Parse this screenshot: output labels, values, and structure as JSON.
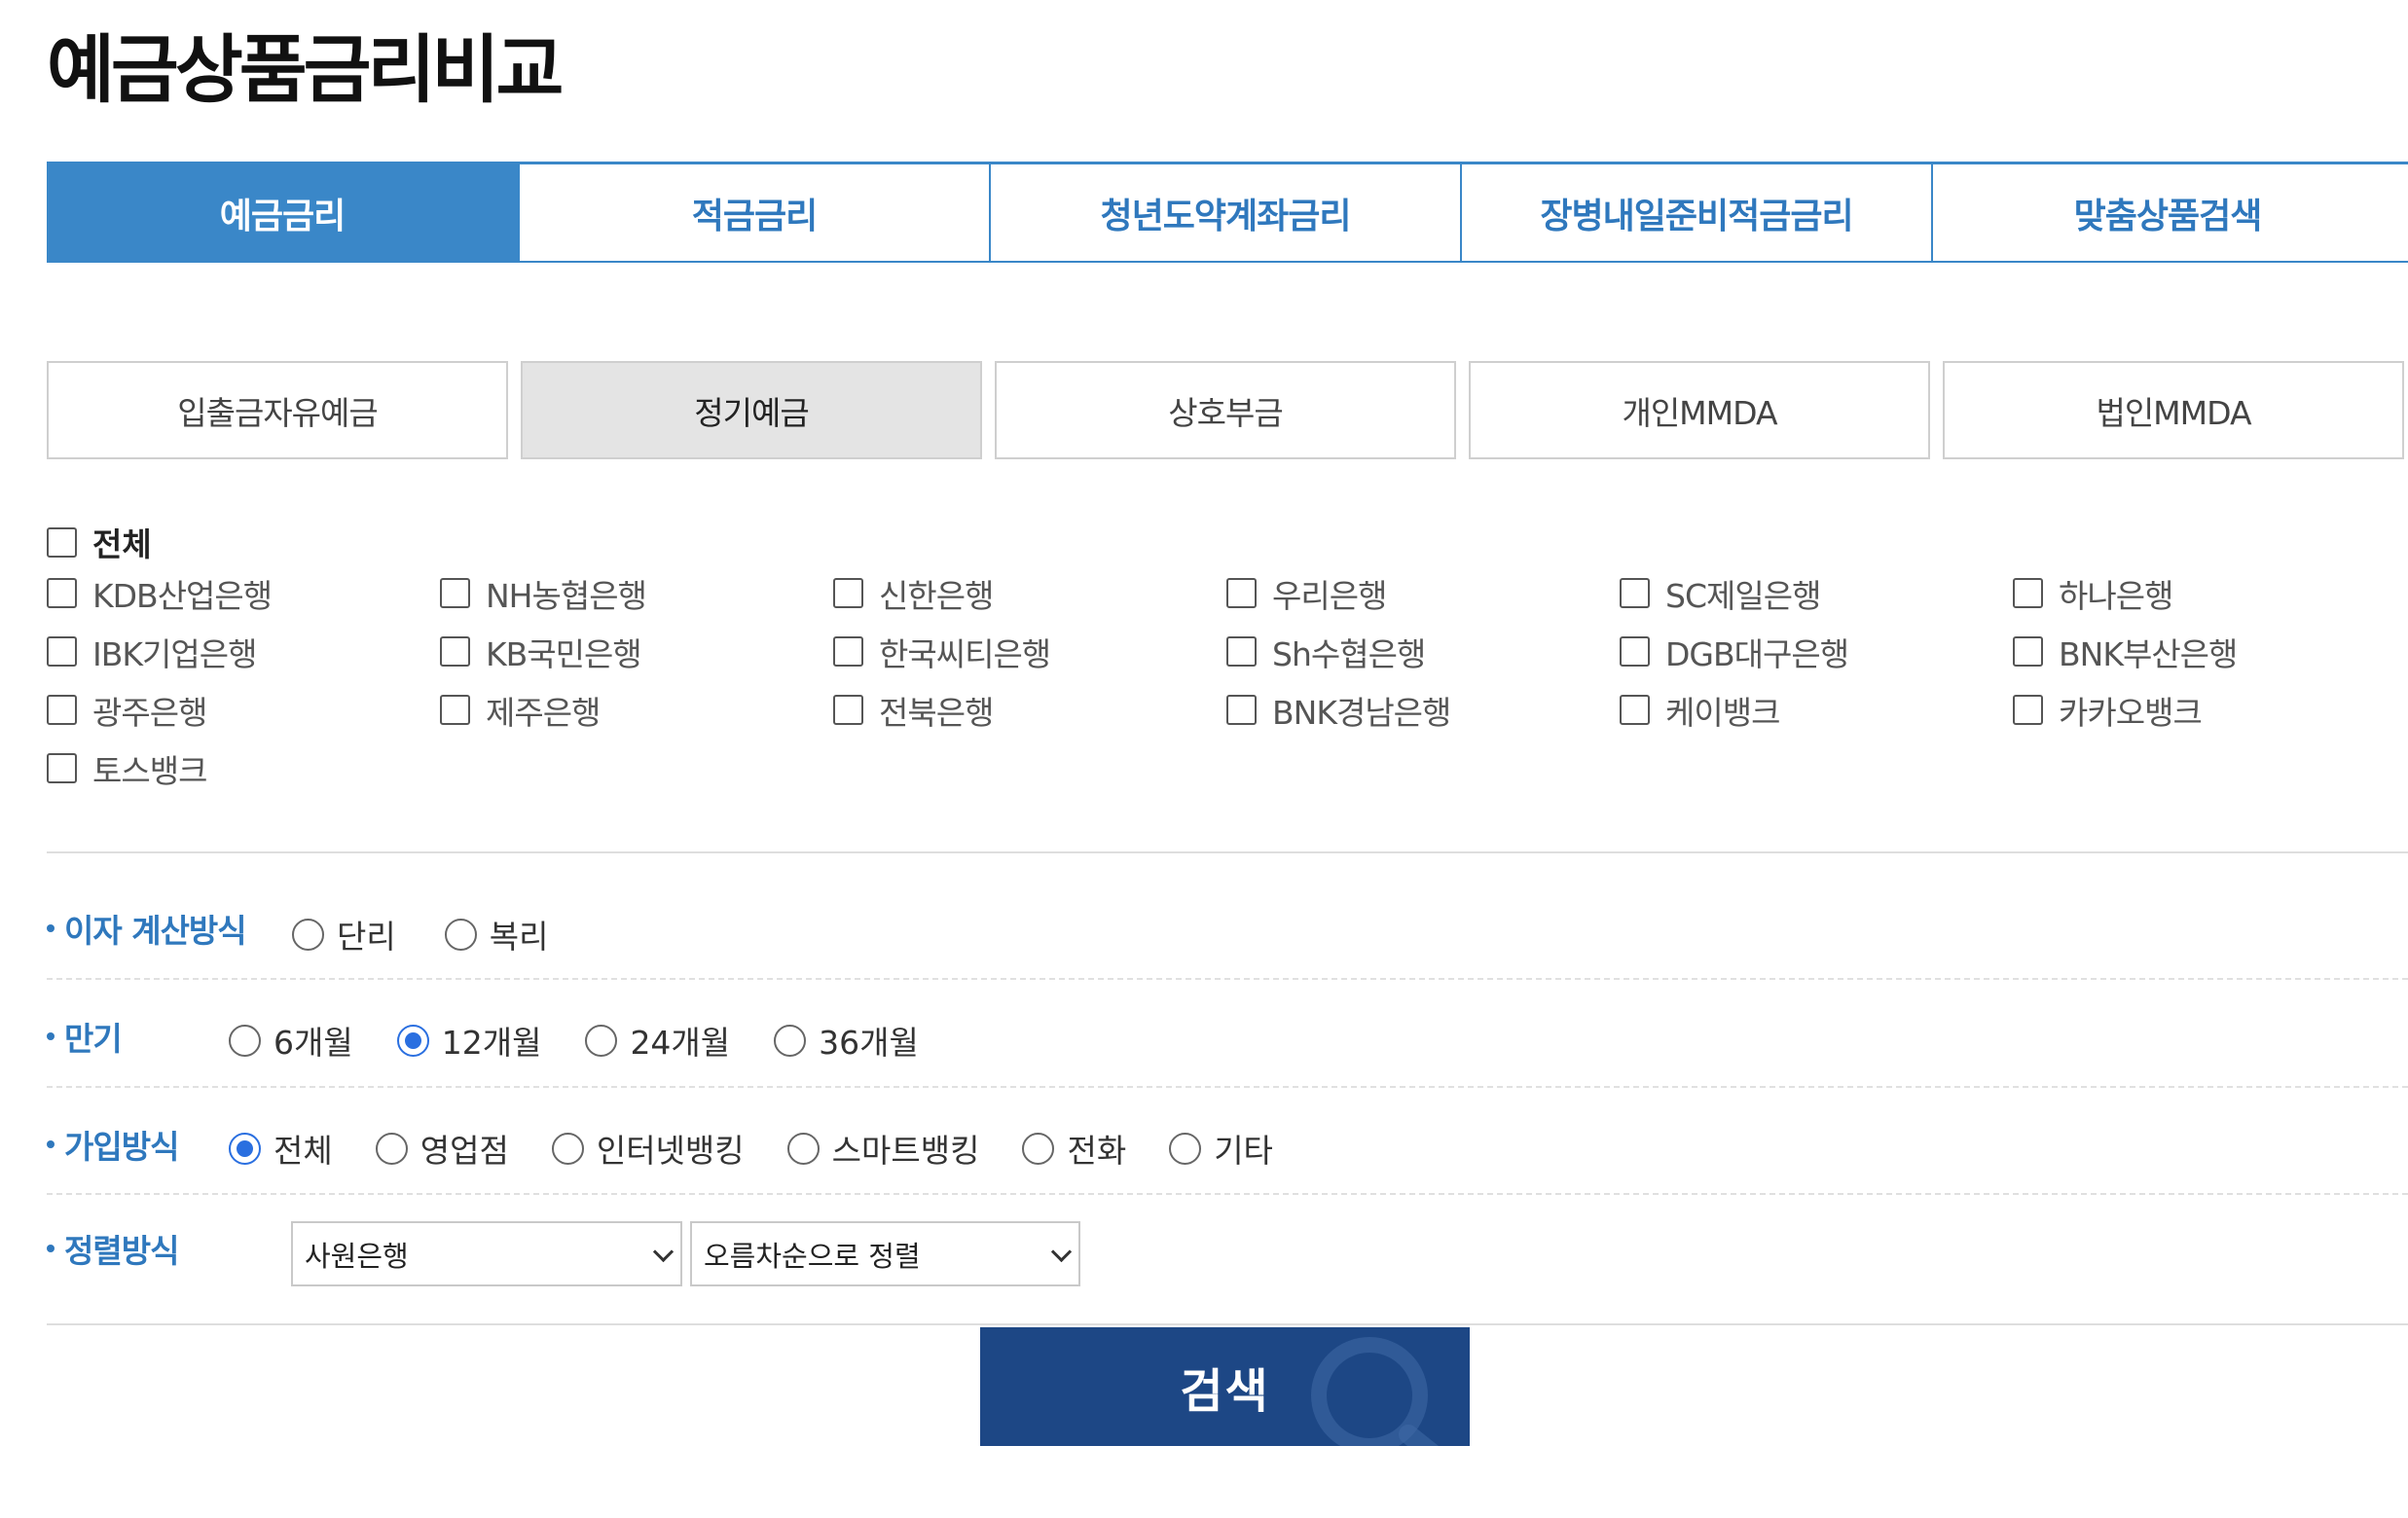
{
  "page": {
    "title": "예금상품금리비교"
  },
  "main_tabs": [
    {
      "label": "예금금리",
      "active": true
    },
    {
      "label": "적금금리",
      "active": false
    },
    {
      "label": "청년도약계좌금리",
      "active": false
    },
    {
      "label": "장병내일준비적금금리",
      "active": false
    },
    {
      "label": "맞춤상품검색",
      "active": false
    }
  ],
  "sub_tabs": [
    {
      "label": "입출금자유예금",
      "active": false
    },
    {
      "label": "정기예금",
      "active": true
    },
    {
      "label": "상호부금",
      "active": false
    },
    {
      "label": "개인MMDA",
      "active": false
    },
    {
      "label": "법인MMDA",
      "active": false
    }
  ],
  "banks": {
    "all_label": "전체",
    "items": [
      "KDB산업은행",
      "NH농협은행",
      "신한은행",
      "우리은행",
      "SC제일은행",
      "하나은행",
      "IBK기업은행",
      "KB국민은행",
      "한국씨티은행",
      "Sh수협은행",
      "DGB대구은행",
      "BNK부산은행",
      "광주은행",
      "제주은행",
      "전북은행",
      "BNK경남은행",
      "케이뱅크",
      "카카오뱅크",
      "토스뱅크"
    ]
  },
  "interest_method": {
    "label": "이자 계산방식",
    "options": [
      "단리",
      "복리"
    ],
    "selected": null
  },
  "maturity": {
    "label": "만기",
    "options": [
      "6개월",
      "12개월",
      "24개월",
      "36개월"
    ],
    "selected": "12개월"
  },
  "join_method": {
    "label": "가입방식",
    "options": [
      "전체",
      "영업점",
      "인터넷뱅킹",
      "스마트뱅킹",
      "전화",
      "기타"
    ],
    "selected": "전체"
  },
  "sort": {
    "label": "정렬방식",
    "field_value": "사원은행",
    "order_value": "오름차순으로 정렬"
  },
  "search_button": {
    "label": "검색"
  },
  "colors": {
    "accent": "#3a87c8",
    "label_blue": "#2f78bd",
    "radio_selected": "#2a6fe0",
    "button_bg": "#1d4785"
  }
}
